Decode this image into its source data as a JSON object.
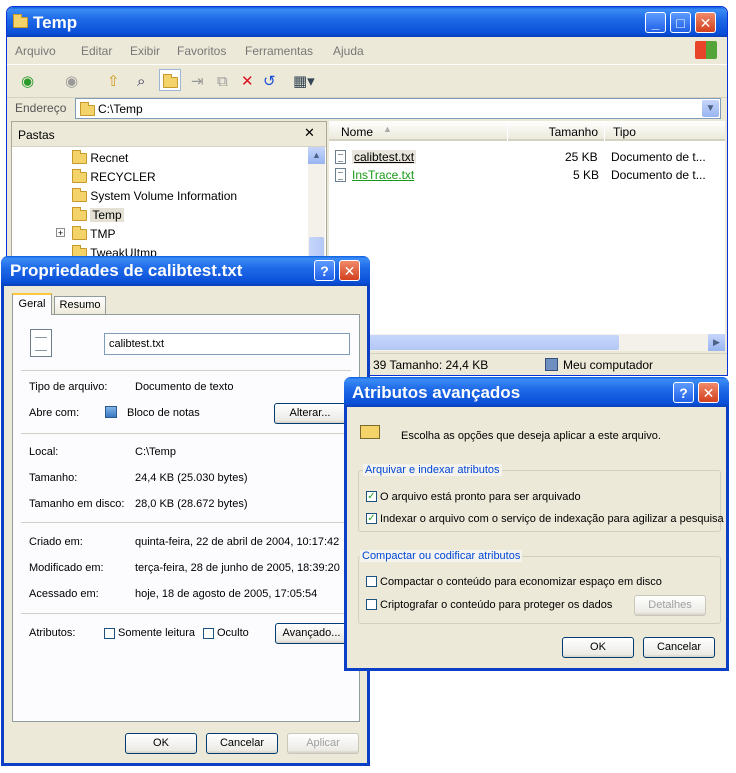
{
  "explorer": {
    "title": "Temp",
    "menu": [
      "Arquivo",
      "Editar",
      "Exibir",
      "Favoritos",
      "Ferramentas",
      "Ajuda"
    ],
    "address_label": "Endereço",
    "address_value": "C:\\Temp",
    "folders_header": "Pastas",
    "tree": [
      "Recnet",
      "RECYCLER",
      "System Volume Information",
      "Temp",
      "TMP",
      "TweakUItmp"
    ],
    "columns": [
      "Nome",
      "Tamanho",
      "Tipo"
    ],
    "files": [
      {
        "name": "calibtest.txt",
        "size": "25 KB",
        "type": "Documento de t..."
      },
      {
        "name": "InsTrace.txt",
        "size": "5 KB",
        "type": "Documento de t..."
      }
    ],
    "status_left": "39 Tamanho: 24,4 KB",
    "status_right": "Meu computador"
  },
  "properties": {
    "title": "Propriedades de calibtest.txt",
    "tabs": [
      "Geral",
      "Resumo"
    ],
    "filename": "calibtest.txt",
    "type_label": "Tipo de arquivo:",
    "type_value": "Documento de texto",
    "opens_label": "Abre com:",
    "opens_value": "Bloco de notas",
    "change_button": "Alterar...",
    "location_label": "Local:",
    "location_value": "C:\\Temp",
    "size_label": "Tamanho:",
    "size_value": "24,4 KB (25.030 bytes)",
    "disk_label": "Tamanho em disco:",
    "disk_value": "28,0 KB (28.672 bytes)",
    "created_label": "Criado em:",
    "created_value": "quinta-feira, 22 de abril de 2004, 10:17:42",
    "modified_label": "Modificado em:",
    "modified_value": "terça-feira, 28 de junho de 2005, 18:39:20",
    "accessed_label": "Acessado em:",
    "accessed_value": "hoje, 18 de agosto de 2005, 17:05:54",
    "attributes_label": "Atributos:",
    "readonly_label": "Somente leitura",
    "hidden_label": "Oculto",
    "advanced_button": "Avançado...",
    "ok": "OK",
    "cancel": "Cancelar",
    "apply": "Aplicar"
  },
  "advanced": {
    "title": "Atributos avançados",
    "description": "Escolha as opções que deseja aplicar a este arquivo.",
    "group1_title": "Arquivar e indexar atributos",
    "archive_label": "O arquivo está pronto para ser arquivado",
    "index_label": "Indexar o arquivo com o serviço de indexação para agilizar a pesquisa",
    "group2_title": "Compactar ou codificar atributos",
    "compress_label": "Compactar o conteúdo para economizar espaço em disco",
    "encrypt_label": "Criptografar o conteúdo para proteger os dados",
    "details_button": "Detalhes",
    "ok": "OK",
    "cancel": "Cancelar"
  }
}
